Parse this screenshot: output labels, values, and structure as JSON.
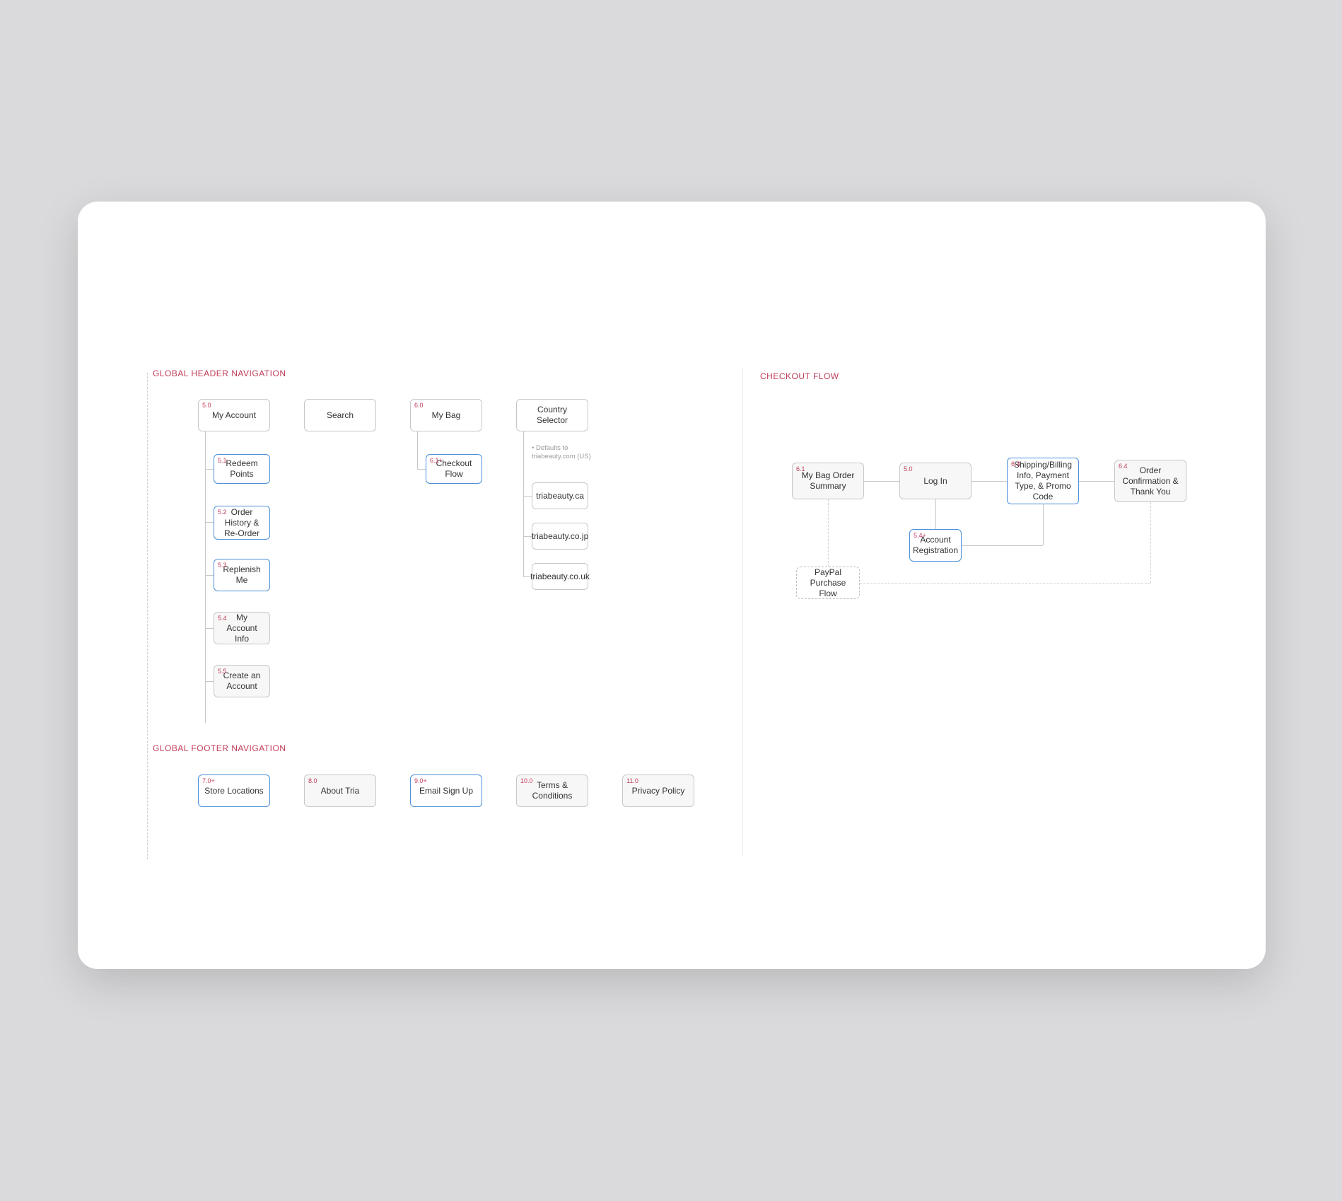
{
  "sections": {
    "header_nav": "GLOBAL HEADER NAVIGATION",
    "footer_nav": "GLOBAL FOOTER NAVIGATION",
    "checkout": "CHECKOUT FLOW"
  },
  "header": {
    "my_account": {
      "num": "5.0",
      "label": "My Account"
    },
    "search": {
      "label": "Search"
    },
    "my_bag": {
      "num": "6.0",
      "label": "My Bag"
    },
    "country_selector": {
      "label": "Country Selector"
    },
    "country_note": "• Defaults to triabeauty.com (US)",
    "my_account_children": [
      {
        "num": "5.1",
        "label": "Redeem Points"
      },
      {
        "num": "5.2",
        "label": "Order History & Re-Order"
      },
      {
        "num": "5.3",
        "label": "Replenish Me"
      },
      {
        "num": "5.4",
        "label": "My Account Info"
      },
      {
        "num": "5.5",
        "label": "Create an Account"
      }
    ],
    "checkout_flow_child": {
      "num": "6.1+",
      "label": "Checkout Flow"
    },
    "countries": [
      {
        "label": "triabeauty.ca"
      },
      {
        "label": "triabeauty.co.jp"
      },
      {
        "label": "triabeauty.co.uk"
      }
    ]
  },
  "footer": [
    {
      "num": "7.0+",
      "label": "Store Locations",
      "blue": true
    },
    {
      "num": "8.0",
      "label": "About Tria"
    },
    {
      "num": "9.0+",
      "label": "Email Sign Up",
      "blue": true
    },
    {
      "num": "10.0",
      "label": "Terms & Conditions"
    },
    {
      "num": "11.0",
      "label": "Privacy Policy"
    }
  ],
  "checkout_flow": {
    "order_summary": {
      "num": "6.1",
      "label": "My Bag Order Summary"
    },
    "login": {
      "num": "5.0",
      "label": "Log In"
    },
    "shipping": {
      "num": "6.3",
      "label": "Shipping/Billing Info, Payment Type, & Promo Code"
    },
    "confirmation": {
      "num": "6.4",
      "label": "Order Confirmation & Thank You"
    },
    "registration": {
      "num": "5.4+",
      "label": "Account Registration"
    },
    "paypal": {
      "label": "PayPal Purchase Flow"
    }
  }
}
